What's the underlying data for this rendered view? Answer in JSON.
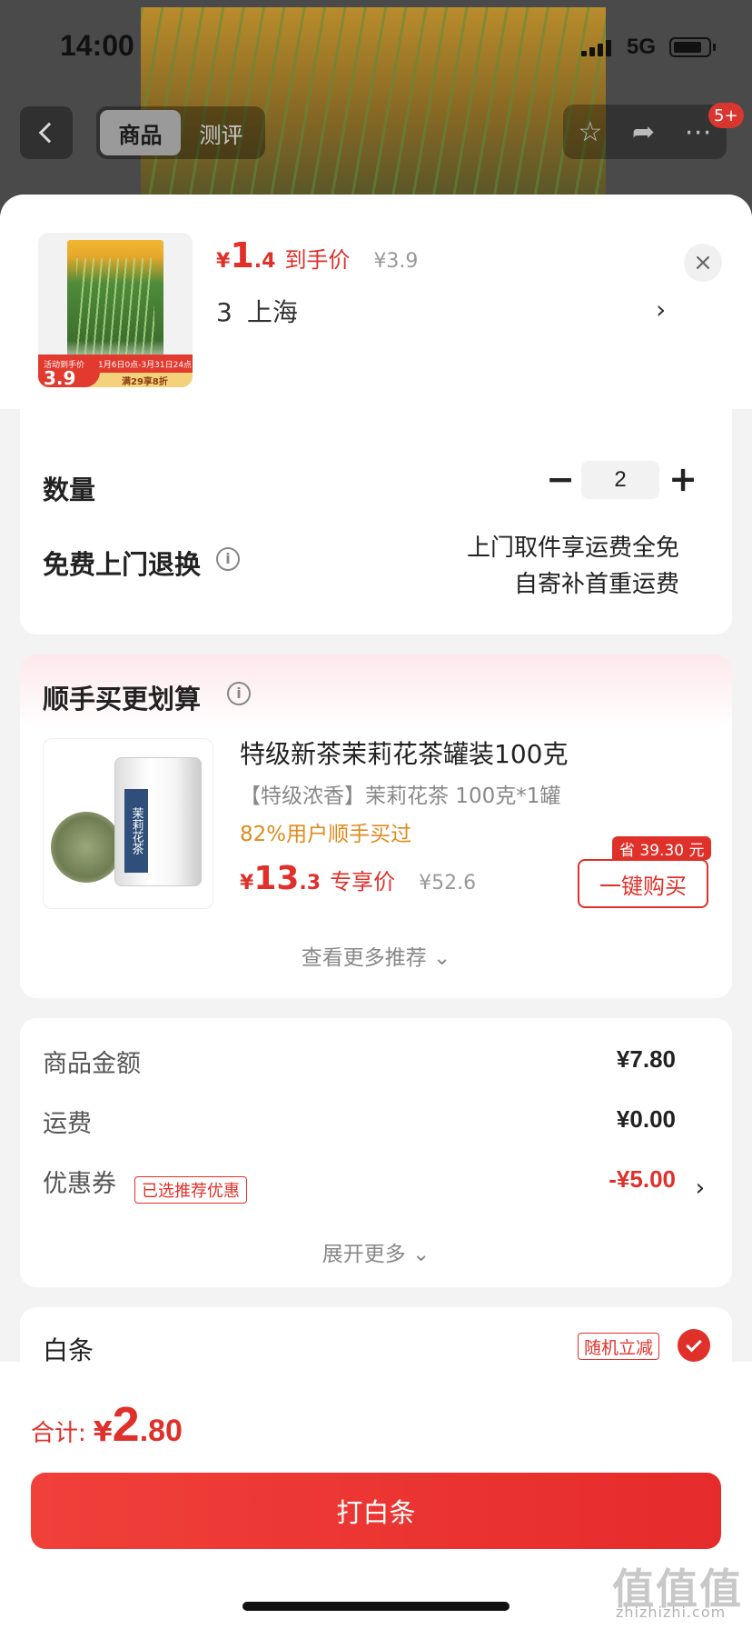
{
  "status_bar": {
    "time": "14:00",
    "network": "5G"
  },
  "nav": {
    "tabs": [
      {
        "label": "商品"
      },
      {
        "label": "测评"
      }
    ],
    "badge": "5+"
  },
  "product": {
    "price_currency": "¥",
    "price_int": "1",
    "price_dec": ".4",
    "price_label": "到手价",
    "original_price": "¥3.9",
    "selection_qty": "3",
    "selection_region": "上海",
    "thumb_tag_label": "活动到手价",
    "thumb_tag_price": "3.9",
    "thumb_bar_text": "1月6日0点-3月31日24点",
    "thumb_bar2_text": "满29享8折"
  },
  "quantity": {
    "label": "数量",
    "value": "2",
    "minus": "−",
    "plus": "+"
  },
  "return_service": {
    "label": "免费上门退换",
    "line1": "上门取件享运费全免",
    "line2": "自寄补首重运费"
  },
  "recommend": {
    "title": "顺手买更划算",
    "name": "特级新茶茉莉花茶罐装100克",
    "desc": "【特级浓香】茉莉花茶 100克*1罐",
    "buy_pct": "82%用户顺手买过",
    "price_currency": "¥",
    "price_int": "13",
    "price_dec": ".3",
    "price_label": "专享价",
    "original_price": "¥52.6",
    "save_tag": "省 39.30 元",
    "buy_button": "一键购买",
    "more": "查看更多推荐 ⌄",
    "can_label": "茉莉花茶"
  },
  "summary": {
    "goods_label": "商品金额",
    "goods_value": "¥7.80",
    "shipping_label": "运费",
    "shipping_value": "¥0.00",
    "coupon_label": "优惠券",
    "coupon_tag": "已选推荐优惠",
    "coupon_value": "-¥5.00",
    "more": "展开更多 ⌄"
  },
  "payment": {
    "method": "白条",
    "tag": "随机立减"
  },
  "total": {
    "label": "合计:",
    "currency": "¥",
    "int": "2",
    "dec": ".80"
  },
  "pay_button": "打白条",
  "watermark": {
    "main": "值值值",
    "sub": "zhizhizhi.com"
  },
  "colors": {
    "accent": "#e0302a",
    "orange": "#e08a1e"
  }
}
